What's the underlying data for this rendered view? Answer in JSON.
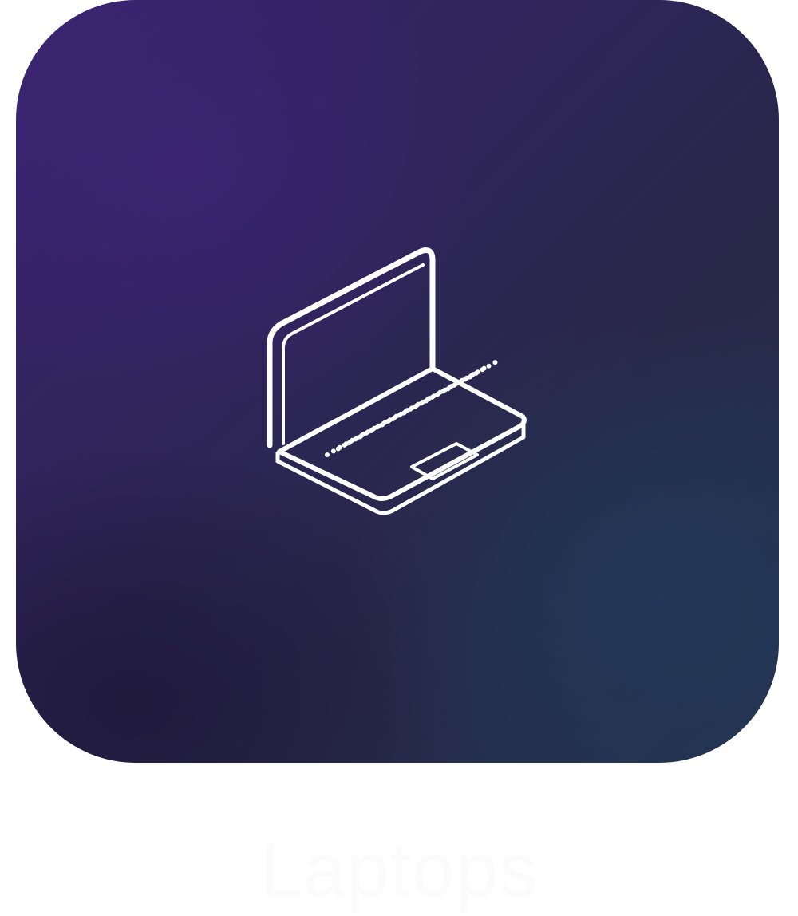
{
  "app_tile": {
    "name": "laptop-app",
    "icon": "laptop-icon",
    "label": "Laptops"
  },
  "colors": {
    "tile_gradient_start": "#3a2470",
    "tile_gradient_mid": "#2e2558",
    "tile_gradient_end": "#23344f",
    "icon_stroke": "#ffffff",
    "label_text": "#fbfbfb",
    "page_background": "#ffffff"
  }
}
